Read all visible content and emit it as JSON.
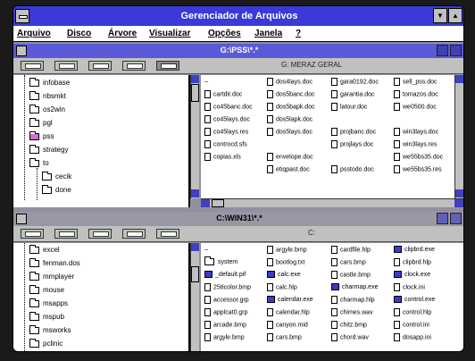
{
  "app": {
    "title": "Gerenciador de Arquivos"
  },
  "menu": [
    "Arquivo",
    "Disco",
    "Árvore",
    "Visualizar",
    "Opções",
    "Janela",
    "?"
  ],
  "window_top": {
    "title": "G:\\PSS\\*.*",
    "dir_label": "G: MERAZ GERAL",
    "tree": [
      "infobase",
      "nbsmkt",
      "os2win",
      "pgl",
      "pss",
      "strategy",
      "to",
      "cecik",
      "done"
    ],
    "files_col1": [
      "..",
      "cartdir.doc",
      "co45banc.doc",
      "co45lays.doc",
      "co45lays.res",
      "controcd.sfs",
      "copias.xls"
    ],
    "files_col2": [
      "dos4lays.doc",
      "dos5banc.doc",
      "dos5bapk.doc",
      "dos5lapk.doc",
      "dos5lays.doc",
      "",
      "envelope.doc",
      "etiqpast.doc"
    ],
    "files_col3": [
      "gara0192.doc",
      "garantia.doc",
      "latour.doc",
      "",
      "projbanc.doc",
      "projlays.doc",
      "",
      "psstodo.doc"
    ],
    "files_col4": [
      "sell_pss.doc",
      "tomazos.doc",
      "we0500.doc",
      "",
      "win3lays.doc",
      "win3lays.res",
      "we55bs35.doc",
      "we55bs35.res"
    ]
  },
  "window_bottom": {
    "title": "C:\\WIN31\\*.*",
    "dir_label": "C:",
    "tree": [
      "excel",
      "fenman.dos",
      "mmplayer",
      "mouse",
      "msapps",
      "mspub",
      "msworks",
      "pclinic"
    ],
    "files_col1": [
      "..",
      "system",
      "_default.pif",
      "256color.bmp",
      "accessor.grp",
      "applcat0.grp",
      "arcade.bmp",
      "argyle.bmp"
    ],
    "files_col2": [
      "argyle.bmp",
      "bootlog.txt",
      "calc.exe",
      "calc.hlp",
      "calendar.exe",
      "calendar.hlp",
      "canyon.mid",
      "cars.bmp"
    ],
    "files_col3": [
      "cardfile.hlp",
      "cars.bmp",
      "castle.bmp",
      "charmap.exe",
      "charmap.hlp",
      "chimes.wav",
      "chitz.bmp",
      "chord.wav"
    ],
    "files_col4": [
      "clipbrd.exe",
      "clipbrd.hlp",
      "clock.exe",
      "clock.ini",
      "control.exe",
      "control.hlp",
      "control.ini",
      "dosapp.ini"
    ]
  }
}
